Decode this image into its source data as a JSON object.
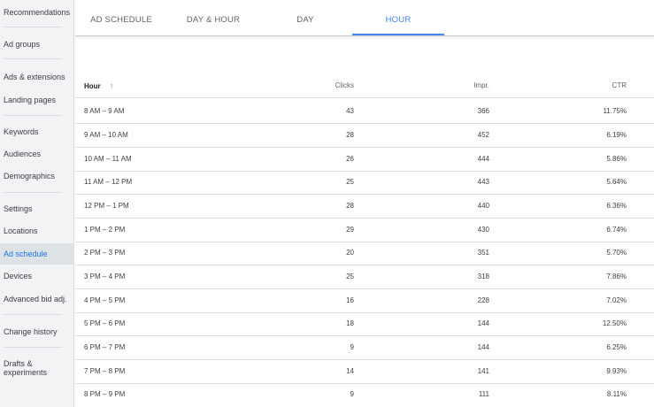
{
  "sidebar": {
    "items": [
      {
        "label": "Recommendations",
        "active": false
      },
      {
        "label": "Ad groups",
        "active": false
      },
      {
        "label": "Ads & extensions",
        "active": false
      },
      {
        "label": "Landing pages",
        "active": false
      },
      {
        "label": "Keywords",
        "active": false
      },
      {
        "label": "Audiences",
        "active": false
      },
      {
        "label": "Demographics",
        "active": false
      },
      {
        "label": "Settings",
        "active": false
      },
      {
        "label": "Locations",
        "active": false
      },
      {
        "label": "Ad schedule",
        "active": true
      },
      {
        "label": "Devices",
        "active": false
      },
      {
        "label": "Advanced bid adj.",
        "active": false
      },
      {
        "label": "Change history",
        "active": false
      },
      {
        "label": "Drafts & experiments",
        "active": false
      }
    ]
  },
  "tabs": [
    {
      "label": "AD SCHEDULE",
      "active": false
    },
    {
      "label": "DAY & HOUR",
      "active": false
    },
    {
      "label": "DAY",
      "active": false
    },
    {
      "label": "HOUR",
      "active": true
    }
  ],
  "table": {
    "headers": {
      "hour": "Hour",
      "clicks": "Clicks",
      "impr": "Impr.",
      "ctr": "CTR"
    },
    "sort_icon": "arrow-up-icon",
    "rows": [
      {
        "hour": "8 AM – 9 AM",
        "clicks": "43",
        "impr": "366",
        "ctr": "11.75%"
      },
      {
        "hour": "9 AM – 10 AM",
        "clicks": "28",
        "impr": "452",
        "ctr": "6.19%"
      },
      {
        "hour": "10 AM – 11 AM",
        "clicks": "26",
        "impr": "444",
        "ctr": "5.86%"
      },
      {
        "hour": "11 AM – 12 PM",
        "clicks": "25",
        "impr": "443",
        "ctr": "5.64%"
      },
      {
        "hour": "12 PM – 1 PM",
        "clicks": "28",
        "impr": "440",
        "ctr": "6.36%"
      },
      {
        "hour": "1 PM – 2 PM",
        "clicks": "29",
        "impr": "430",
        "ctr": "6.74%"
      },
      {
        "hour": "2 PM – 3 PM",
        "clicks": "20",
        "impr": "351",
        "ctr": "5.70%"
      },
      {
        "hour": "3 PM – 4 PM",
        "clicks": "25",
        "impr": "318",
        "ctr": "7.86%"
      },
      {
        "hour": "4 PM – 5 PM",
        "clicks": "16",
        "impr": "228",
        "ctr": "7.02%"
      },
      {
        "hour": "5 PM – 6 PM",
        "clicks": "18",
        "impr": "144",
        "ctr": "12.50%"
      },
      {
        "hour": "6 PM – 7 PM",
        "clicks": "9",
        "impr": "144",
        "ctr": "6.25%"
      },
      {
        "hour": "7 PM – 8 PM",
        "clicks": "14",
        "impr": "141",
        "ctr": "9.93%"
      },
      {
        "hour": "8 PM – 9 PM",
        "clicks": "9",
        "impr": "111",
        "ctr": "8.11%"
      }
    ]
  },
  "colors": {
    "accent": "#4285f4",
    "active_nav_bg": "#dde2e6"
  }
}
